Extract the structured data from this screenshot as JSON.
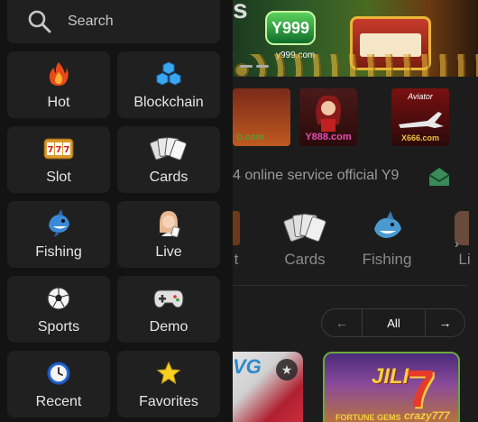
{
  "background": {
    "banner": {
      "partial_text": "s",
      "logo_text": "Y999",
      "url_text": "y999.com"
    },
    "brands": [
      {
        "top": "",
        "label": "D.com"
      },
      {
        "top": "",
        "label": "Y888.com"
      },
      {
        "top": "Aviator",
        "label": "X666.com"
      }
    ],
    "marquee_text": "4 online service official Y9",
    "categories": [
      {
        "label": "t",
        "icon": "partial-icon"
      },
      {
        "label": "Cards",
        "icon": "playing-cards-icon"
      },
      {
        "label": "Fishing",
        "icon": "shark-icon"
      },
      {
        "label": "Li",
        "icon": "partial-icon"
      }
    ],
    "filter": {
      "prev_icon": "←",
      "label": "All",
      "next_icon": "→"
    },
    "games": [
      {
        "title": "VG",
        "favorite_icon": "★"
      },
      {
        "title": "JILI",
        "number": "7",
        "subtitle": "FORTUNE GEMS",
        "subtitle2": "crazy777"
      }
    ]
  },
  "drawer": {
    "search": {
      "label": "Search"
    },
    "menu": [
      {
        "label": "Hot",
        "icon": "flame-icon"
      },
      {
        "label": "Blockchain",
        "icon": "blockchain-cubes-icon"
      },
      {
        "label": "Slot",
        "icon": "slot-777-icon"
      },
      {
        "label": "Cards",
        "icon": "playing-cards-icon"
      },
      {
        "label": "Fishing",
        "icon": "shark-icon"
      },
      {
        "label": "Live",
        "icon": "dealer-girl-icon"
      },
      {
        "label": "Sports",
        "icon": "soccer-ball-icon"
      },
      {
        "label": "Demo",
        "icon": "gamepad-icon"
      },
      {
        "label": "Recent",
        "icon": "clock-icon"
      },
      {
        "label": "Favorites",
        "icon": "star-icon"
      }
    ]
  },
  "colors": {
    "drawer_bg": "#131313",
    "tile_bg": "#202020",
    "page_bg": "#1c1c1c",
    "text": "#e6e6e6",
    "muted_text": "#8a8a8a"
  }
}
